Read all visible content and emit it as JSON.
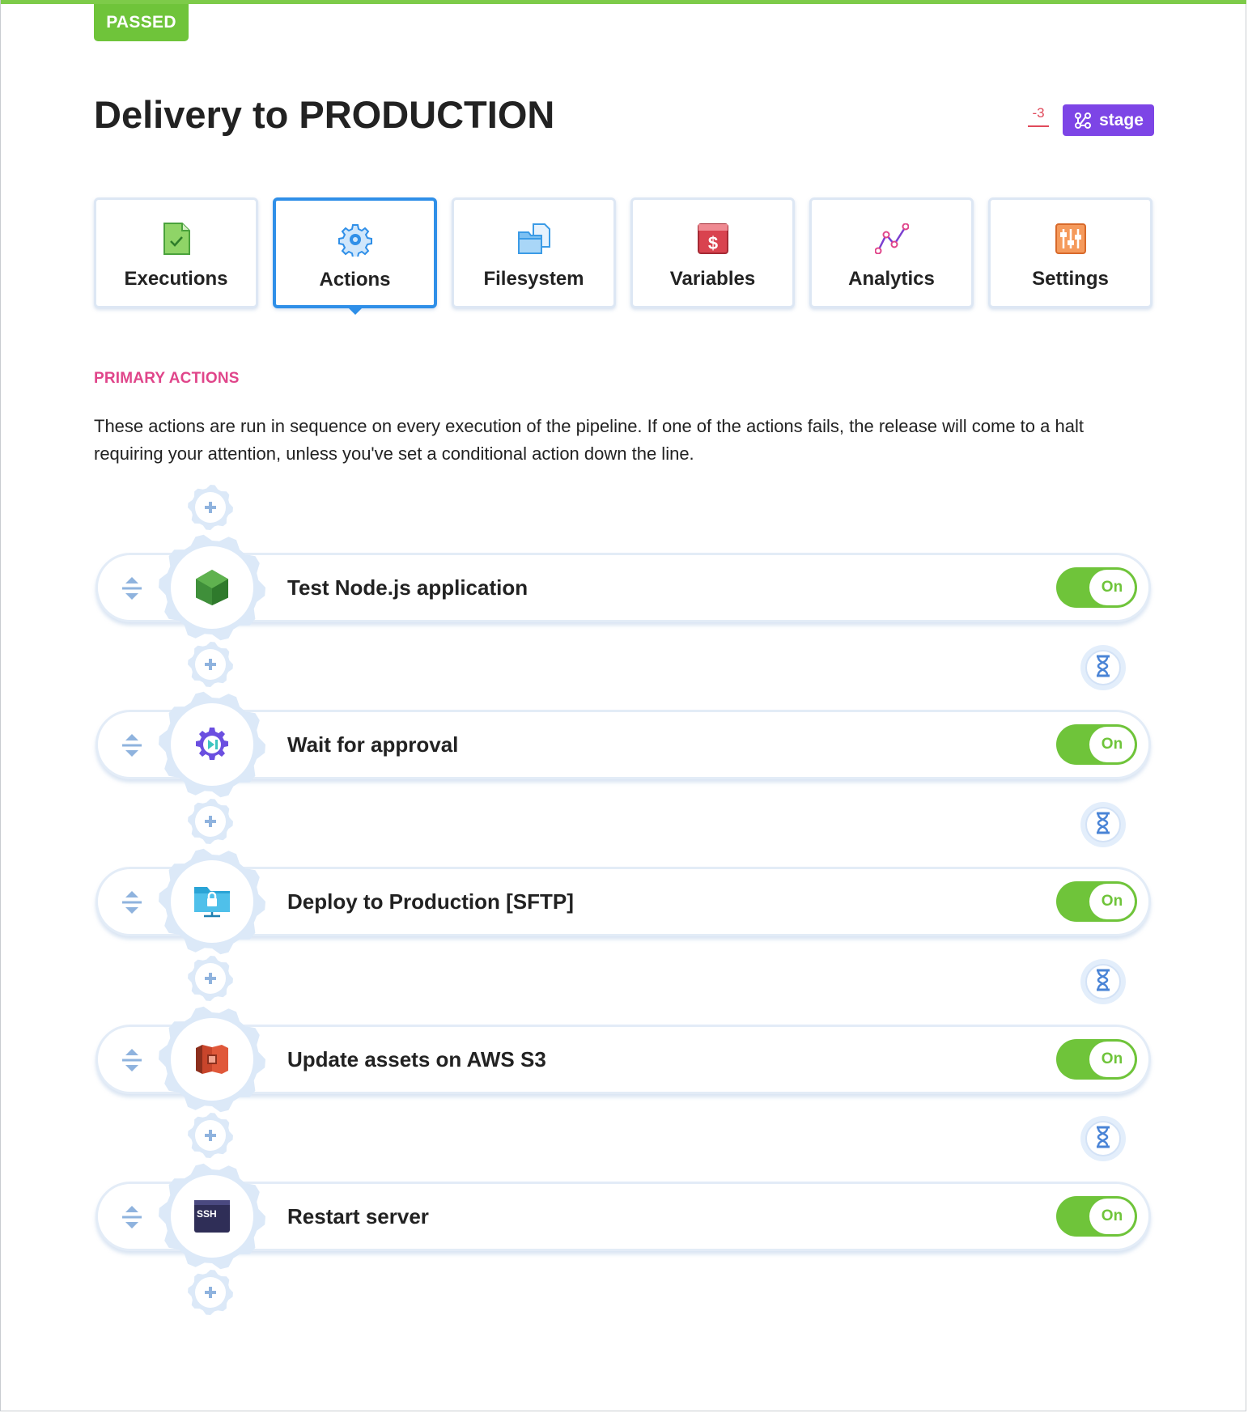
{
  "status_badge": "PASSED",
  "page_title": "Delivery to PRODUCTION",
  "revision": "-3",
  "stage_button": "stage",
  "tabs": [
    {
      "label": "Executions",
      "icon": "document-check-icon",
      "active": false
    },
    {
      "label": "Actions",
      "icon": "gear-icon",
      "active": true
    },
    {
      "label": "Filesystem",
      "icon": "folder-files-icon",
      "active": false
    },
    {
      "label": "Variables",
      "icon": "dollar-icon",
      "active": false
    },
    {
      "label": "Analytics",
      "icon": "line-graph-icon",
      "active": false
    },
    {
      "label": "Settings",
      "icon": "sliders-icon",
      "active": false
    }
  ],
  "section": {
    "title": "PRIMARY ACTIONS",
    "description": "These actions are run in sequence on every execution of the pipeline. If one of the actions fails, the release will come to a halt requiring your attention, unless you've set a conditional action down the line."
  },
  "actions": [
    {
      "name": "Test Node.js application",
      "toggle": "On",
      "icon": "nodejs-icon"
    },
    {
      "name": "Wait for approval",
      "toggle": "On",
      "icon": "approval-gear-icon"
    },
    {
      "name": "Deploy to Production [SFTP]",
      "toggle": "On",
      "icon": "sftp-folder-icon"
    },
    {
      "name": "Update assets on AWS S3",
      "toggle": "On",
      "icon": "aws-s3-icon"
    },
    {
      "name": "Restart server",
      "toggle": "On",
      "icon": "ssh-terminal-icon",
      "icon_text": "SSH"
    }
  ],
  "colors": {
    "passed": "#6fc43a",
    "stage": "#7d45e6",
    "active_tab": "#2f8fe8",
    "section_title": "#e0458a",
    "toggle_on": "#6fc43a"
  }
}
